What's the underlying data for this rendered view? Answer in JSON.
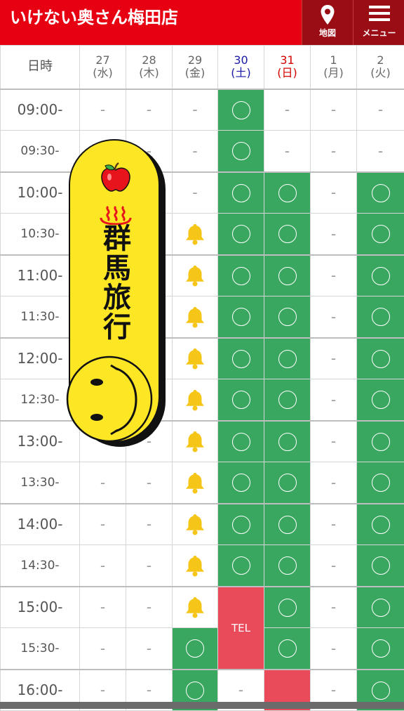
{
  "header": {
    "title": "いけない奥さん梅田店",
    "map_label": "地図",
    "menu_label": "メニュー"
  },
  "banner": {
    "text": "群馬旅行"
  },
  "schedule": {
    "corner": "日時",
    "days": [
      {
        "date": "27",
        "dow": "(水)",
        "type": "weekday"
      },
      {
        "date": "28",
        "dow": "(木)",
        "type": "weekday"
      },
      {
        "date": "29",
        "dow": "(金)",
        "type": "weekday"
      },
      {
        "date": "30",
        "dow": "(土)",
        "type": "sat"
      },
      {
        "date": "31",
        "dow": "(日)",
        "type": "sun"
      },
      {
        "date": "1",
        "dow": "(月)",
        "type": "weekday"
      },
      {
        "date": "2",
        "dow": "(火)",
        "type": "weekday"
      }
    ],
    "rows": [
      {
        "time": "09:00-",
        "cells": [
          "-",
          "-",
          "-",
          "O",
          "-",
          "-",
          "-"
        ]
      },
      {
        "time": "09:30-",
        "cells": [
          "-",
          "-",
          "-",
          "O",
          "-",
          "-",
          "-"
        ]
      },
      {
        "time": "10:00-",
        "cells": [
          "-",
          "-",
          "-",
          "O",
          "O",
          "-",
          "O"
        ]
      },
      {
        "time": "10:30-",
        "cells": [
          "-",
          "-",
          "bell",
          "O",
          "O",
          "-",
          "O"
        ]
      },
      {
        "time": "11:00-",
        "cells": [
          "-",
          "-",
          "bell",
          "O",
          "O",
          "-",
          "O"
        ]
      },
      {
        "time": "11:30-",
        "cells": [
          "-",
          "-",
          "bell",
          "O",
          "O",
          "-",
          "O"
        ]
      },
      {
        "time": "12:00-",
        "cells": [
          "-",
          "-",
          "bell",
          "O",
          "O",
          "-",
          "O"
        ]
      },
      {
        "time": "12:30-",
        "cells": [
          "-",
          "-",
          "bell",
          "O",
          "O",
          "-",
          "O"
        ]
      },
      {
        "time": "13:00-",
        "cells": [
          "-",
          "-",
          "bell",
          "O",
          "O",
          "-",
          "O"
        ]
      },
      {
        "time": "13:30-",
        "cells": [
          "-",
          "-",
          "bell",
          "O",
          "O",
          "-",
          "O"
        ]
      },
      {
        "time": "14:00-",
        "cells": [
          "-",
          "-",
          "bell",
          "O",
          "O",
          "-",
          "O"
        ]
      },
      {
        "time": "14:30-",
        "cells": [
          "-",
          "-",
          "bell",
          "O",
          "O",
          "-",
          "O"
        ]
      },
      {
        "time": "15:00-",
        "cells": [
          "-",
          "-",
          "bell",
          "TEL",
          "O",
          "-",
          "O"
        ]
      },
      {
        "time": "15:30-",
        "cells": [
          "-",
          "-",
          "O",
          "TEL",
          "O",
          "-",
          "O"
        ]
      },
      {
        "time": "16:00-",
        "cells": [
          "-",
          "-",
          "O",
          "-",
          "RED",
          "-",
          "O"
        ]
      }
    ],
    "tel_label": "TEL"
  },
  "colors": {
    "brand_red": "#e60012",
    "header_button": "#9b0d14",
    "available_green": "#3aa760",
    "tel_red": "#e94b5a",
    "bell_yellow": "#f5c518",
    "saturday_blue": "#1a1aa6",
    "sunday_red": "#d40000"
  }
}
